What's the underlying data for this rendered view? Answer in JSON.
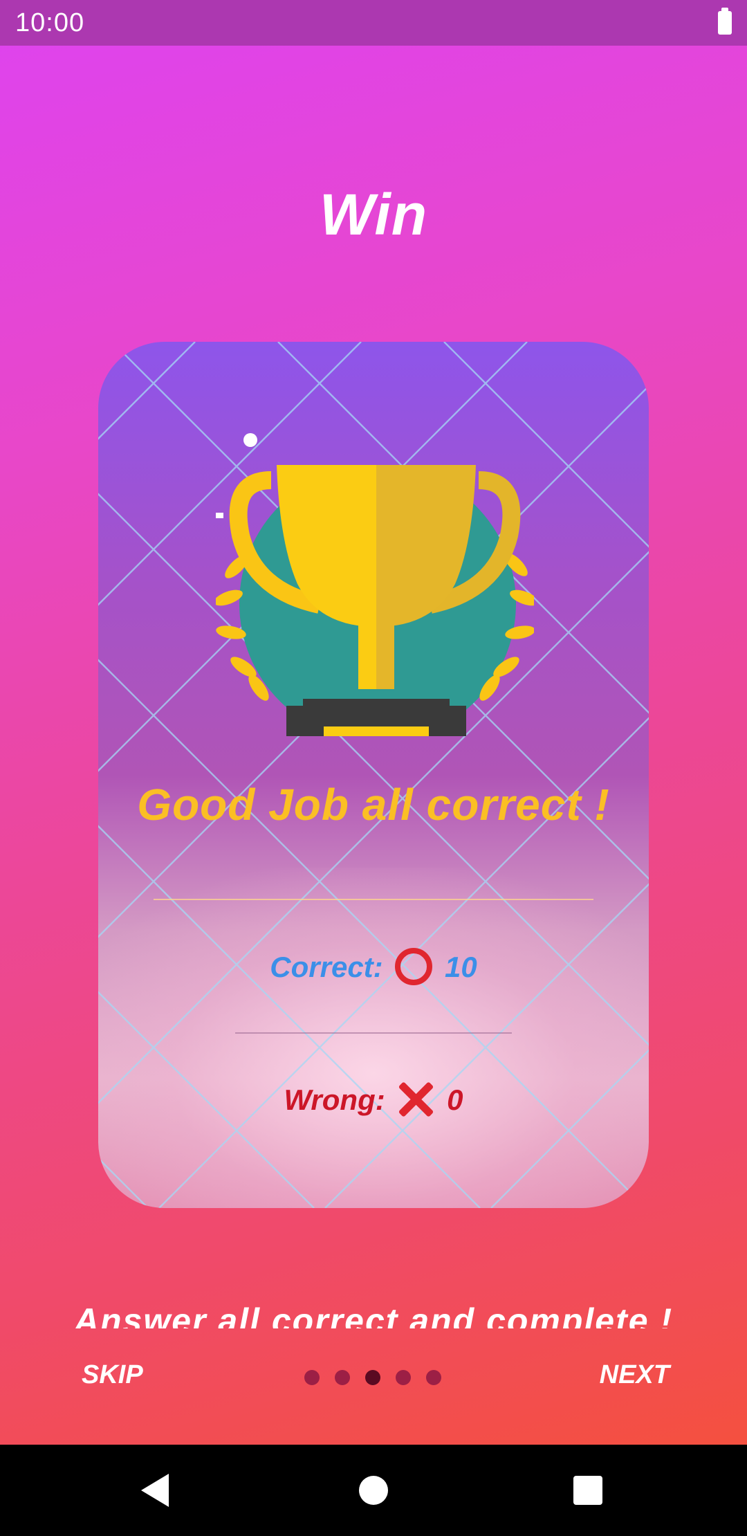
{
  "status_bar": {
    "time": "10:00"
  },
  "page": {
    "title": "Win"
  },
  "card": {
    "headline": "Good Job all correct !",
    "correct_label": "Correct:",
    "correct_value": "10",
    "wrong_label": "Wrong:",
    "wrong_value": "0"
  },
  "subtitle": "Answer all correct and complete !",
  "navigation": {
    "skip_label": "SKIP",
    "next_label": "NEXT",
    "page_count": 5,
    "active_page": 3
  },
  "colors": {
    "headline": "#fbbf24",
    "correct": "#3b8fe8",
    "wrong": "#cc1628",
    "mark": "#e0262f"
  },
  "icons": [
    "battery-icon",
    "trophy-icon",
    "circle-icon",
    "cross-icon",
    "back-icon",
    "home-icon",
    "recents-icon"
  ]
}
